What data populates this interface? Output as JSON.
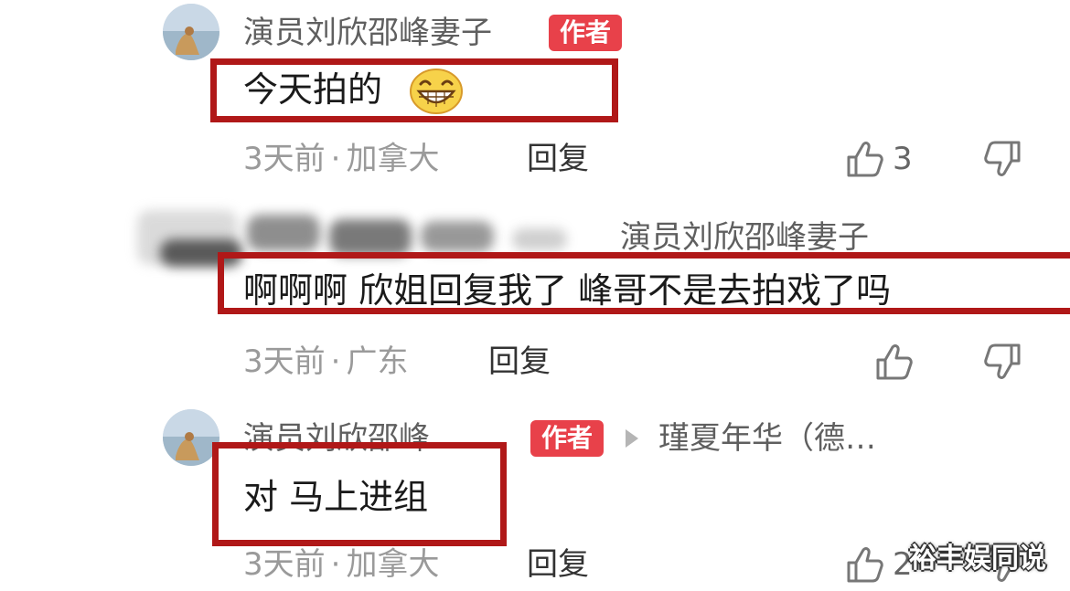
{
  "comments": [
    {
      "author": "演员刘欣邵峰妻子",
      "badge": "作者",
      "text": "今天拍的",
      "emoji": "grinning-face-icon",
      "time": "3天前",
      "location": "加拿大",
      "reply_label": "回复",
      "likes": "3"
    },
    {
      "reply_to": "演员刘欣邵峰妻子",
      "text": "啊啊啊 欣姐回复我了 峰哥不是去拍戏了吗",
      "time": "3天前",
      "location": "广东",
      "reply_label": "回复"
    },
    {
      "author": "演员刘欣邵峰…",
      "badge": "作者",
      "reply_to": "瑾夏年华（德…",
      "text": "对 马上进组",
      "time": "3天前",
      "location": "加拿大",
      "reply_label": "回复",
      "likes": "2"
    }
  ],
  "separator": "·",
  "watermark": "裕丰娱同说",
  "colors": {
    "badge": "#e8414a",
    "highlight_box": "#b01818",
    "meta_text": "#9a9a9a"
  }
}
